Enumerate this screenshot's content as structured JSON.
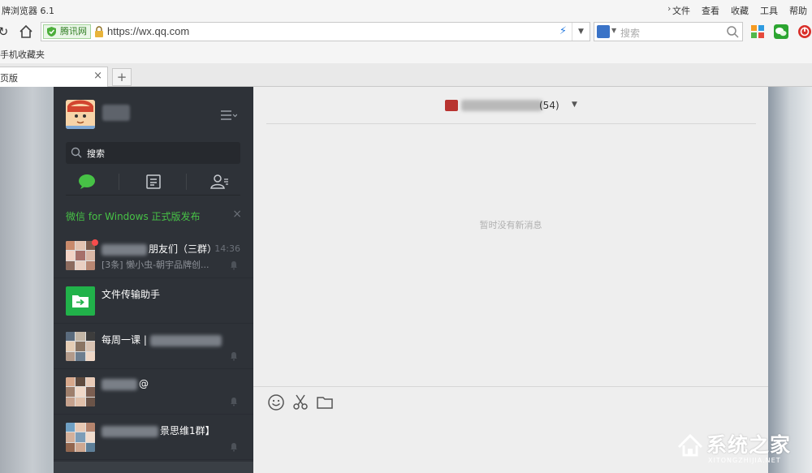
{
  "browser": {
    "title": "牌浏览器 6.1",
    "menu": [
      "文件",
      "查看",
      "收藏",
      "工具",
      "帮助"
    ],
    "secure_label": "腾讯网",
    "url": "https://wx.qq.com",
    "search_placeholder": "搜索",
    "favorites_label": "手机收藏夹",
    "tab_label": "页版",
    "tab_close": "×",
    "new_tab": "+"
  },
  "sidebar": {
    "search_placeholder": "搜索",
    "notice": "微信 for Windows 正式版发布",
    "notice_close": "×",
    "conversations": [
      {
        "name_suffix": "朋友们（三群）",
        "time": "14:36",
        "preview": "[3条] 懒小虫-朝宇品牌创...",
        "unread": true
      },
      {
        "name_suffix": "文件传输助手",
        "time": "",
        "preview": "",
        "unread": false
      },
      {
        "name_prefix": "每周一课 |",
        "time": "",
        "preview": "",
        "unread": false
      },
      {
        "name_suffix": "@",
        "time": "",
        "preview": "",
        "unread": false
      },
      {
        "name_suffix": "景思维1群】",
        "time": "",
        "preview": "",
        "unread": false
      }
    ]
  },
  "chat": {
    "member_count": "(54)",
    "empty_text": "暂时没有新消息"
  },
  "watermark": {
    "text": "系统之家",
    "url": "XITONGZHIJIA.NET"
  },
  "colors": {
    "sidebar_bg": "#2e3238",
    "wechat_green": "#47c246",
    "chat_bg": "#eeeeee",
    "unread_dot": "#f74c4c"
  }
}
